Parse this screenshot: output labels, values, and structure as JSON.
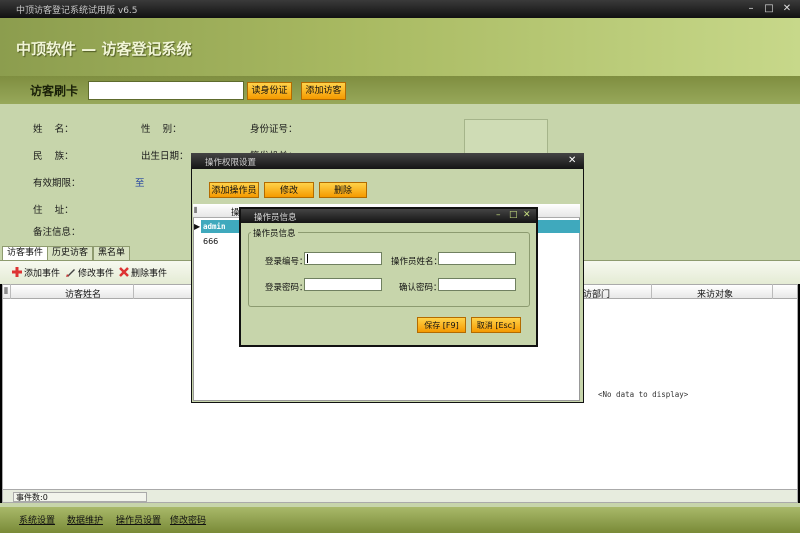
{
  "window": {
    "title": "中顶访客登记系统试用版 v6.5",
    "min": "–",
    "max": "□",
    "close": "✕"
  },
  "banner": {
    "brand": "中顶软件 — 访客登记系统"
  },
  "swipe": {
    "label": "访客刷卡",
    "read_id": "读身份证",
    "add_visitor": "添加访客"
  },
  "info": {
    "name": "姓    名：",
    "gender": "性    别：",
    "id_no": "身份证号：",
    "ethnic": "民    族：",
    "birth": "出生日期：",
    "authority": "签发机关：",
    "validity": "有效期限：",
    "validity_sep": "至",
    "address": "住    址：",
    "remark": "备注信息："
  },
  "tabs": [
    "访客事件",
    "历史访客",
    "黑名单"
  ],
  "toolbar": {
    "add": "添加事件",
    "edit": "修改事件",
    "delete": "删除事件"
  },
  "grid": {
    "columns": [
      "访客姓名",
      "访部门",
      "来访对象"
    ],
    "empty": "<No data to display>"
  },
  "status": {
    "count": "事件数:0"
  },
  "bottom_links": [
    "系统设置",
    "数据维护",
    "操作员设置",
    "修改密码"
  ],
  "dialog1": {
    "title": "操作权限设置",
    "close": "✕",
    "buttons": [
      "添加操作员",
      "修改",
      "删除"
    ],
    "col_head": "操",
    "rows": [
      "admin",
      "666"
    ]
  },
  "dialog2": {
    "title": "操作员信息",
    "min": "–",
    "max": "□",
    "close": "✕",
    "group": "操作员信息",
    "login_no": "登录编号：",
    "op_name": "操作员姓名：",
    "login_pwd": "登录密码：",
    "confirm_pwd": "确认密码：",
    "save": "保存 [F9]",
    "cancel": "取消 [Esc]"
  },
  "colors": {
    "accent": "#f59a00",
    "panel": "#c7d5ab",
    "selection": "#3fa9bd"
  }
}
